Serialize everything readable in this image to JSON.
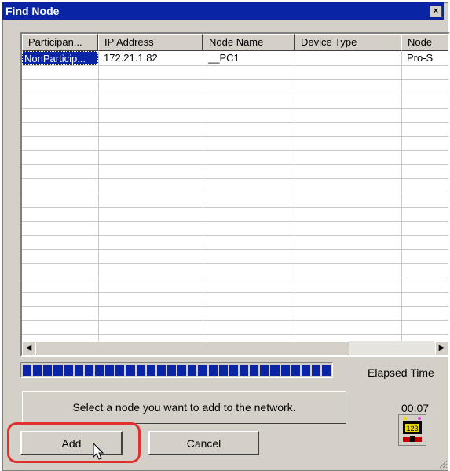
{
  "window": {
    "title": "Find Node",
    "close_glyph": "×"
  },
  "table": {
    "columns": [
      "Participan...",
      "IP Address",
      "Node Name",
      "Device Type",
      "Node"
    ],
    "rows": [
      [
        "NonParticip...",
        "172.21.1.82",
        "__PC1",
        "",
        "Pro-S"
      ]
    ]
  },
  "scrollbar": {
    "left_glyph": "◀",
    "right_glyph": "▶"
  },
  "progress": {
    "fraction": 1.0,
    "segments": 30
  },
  "elapsed": {
    "label": "Elapsed Time",
    "time": "00:07"
  },
  "message": "Select a node you want to add to the network.",
  "buttons": {
    "add": "Add",
    "cancel": "Cancel"
  },
  "colors": {
    "titlebar": "#0a24a6",
    "highlight": "#e03030"
  }
}
